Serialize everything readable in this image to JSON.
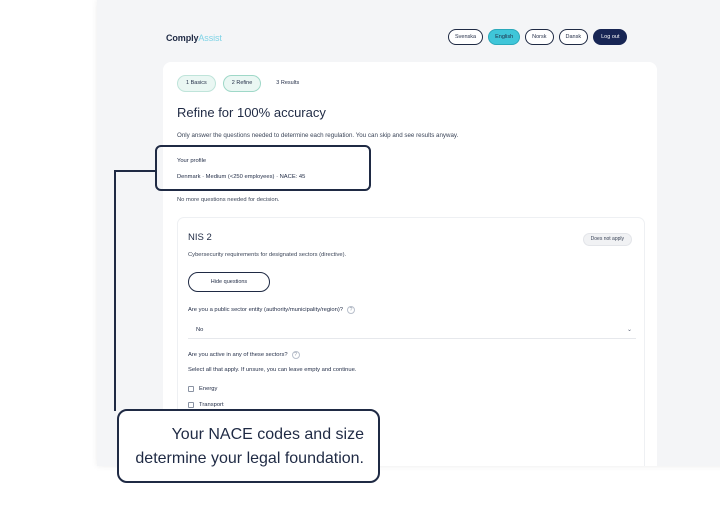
{
  "header": {
    "logo_main": "Comply",
    "logo_accent": "Assist",
    "languages": [
      "Svenska",
      "English",
      "Norsk",
      "Dansk"
    ],
    "active_language": "English",
    "logout_label": "Log out"
  },
  "stepper": {
    "steps": [
      {
        "label": "1  Basics",
        "state": "done"
      },
      {
        "label": "2  Refine",
        "state": "current"
      },
      {
        "label": "3  Results",
        "state": "pending"
      }
    ]
  },
  "main": {
    "title": "Refine for 100% accuracy",
    "subtitle": "Only answer the questions needed to determine each regulation. You can skip and see results anyway.",
    "profile_label": "Your profile",
    "profile_value": "Denmark · Medium (<250 employees) · NACE: 45",
    "no_more_questions": "No more questions needed for decision."
  },
  "regulation": {
    "title": "NIS 2",
    "badge": "Does not apply",
    "description": "Cybersecurity requirements for designated sectors (directive).",
    "hide_button": "Hide questions",
    "q1_label": "Are you a public sector entity (authority/municipality/region)?",
    "q1_value": "No",
    "q2_label": "Are you active in any of these sectors?",
    "q2_help": "Select all that apply. If unsure, you can leave empty and continue.",
    "sectors": [
      "Energy",
      "Transport"
    ]
  },
  "callout": {
    "text": "Your NACE codes and size determine your legal foundation."
  },
  "colors": {
    "navy": "#1f2a44",
    "accent_cyan": "#3fc6d9",
    "step_green": "#eaf7f3"
  }
}
